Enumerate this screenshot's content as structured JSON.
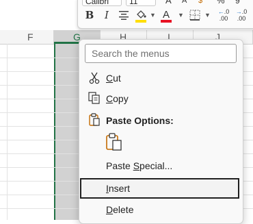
{
  "spreadsheet": {
    "columns": [
      "F",
      "G",
      "H",
      "I",
      "J"
    ],
    "selected_column": "G",
    "accent": "#217346"
  },
  "toolbar": {
    "font_name": "Calibri",
    "font_size": "11",
    "bold_label": "B",
    "italic_label": "I",
    "fill_color": "#ffde00",
    "font_color": "#e81123",
    "percent_label": "%",
    "decimal_labels": [
      ".00",
      ".0"
    ]
  },
  "menu": {
    "search_placeholder": "Search the menus",
    "items": [
      {
        "key": "cut",
        "label": "Cut",
        "icon": "scissors-icon"
      },
      {
        "key": "copy",
        "label": "Copy",
        "icon": "copy-icon"
      },
      {
        "key": "paste_options",
        "label": "Paste Options:",
        "icon": "clipboard-icon"
      },
      {
        "key": "paste_special",
        "label": "Paste Special...",
        "icon": ""
      },
      {
        "key": "insert",
        "label": "Insert",
        "icon": ""
      },
      {
        "key": "delete",
        "label": "Delete",
        "icon": ""
      }
    ],
    "highlighted": "insert"
  }
}
